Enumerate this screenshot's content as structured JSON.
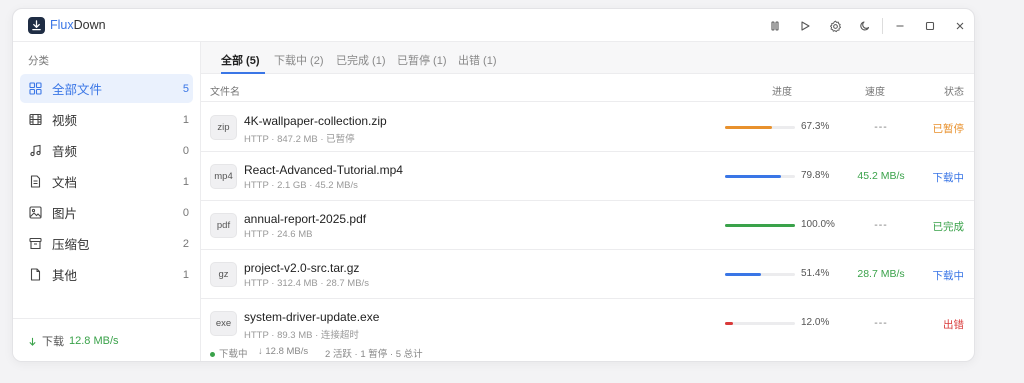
{
  "app": {
    "title_prefix": "Flux",
    "title_suffix": "Down"
  },
  "sidebar": {
    "heading": "分类",
    "items": [
      {
        "label": "全部文件",
        "count": "5",
        "icon": "grid-icon",
        "active": true
      },
      {
        "label": "视频",
        "count": "1",
        "icon": "film-icon"
      },
      {
        "label": "音频",
        "count": "0",
        "icon": "music-icon"
      },
      {
        "label": "文档",
        "count": "1",
        "icon": "document-icon"
      },
      {
        "label": "图片",
        "count": "0",
        "icon": "image-icon"
      },
      {
        "label": "压缩包",
        "count": "2",
        "icon": "archive-icon"
      },
      {
        "label": "其他",
        "count": "1",
        "icon": "file-icon"
      }
    ],
    "footer": {
      "label": "下载",
      "speed": "12.8 MB/s"
    }
  },
  "tabs": [
    {
      "label": "全部 (5)",
      "active": true
    },
    {
      "label": "下载中 (2)"
    },
    {
      "label": "已完成 (1)"
    },
    {
      "label": "已暂停 (1)"
    },
    {
      "label": "出错 (1)"
    }
  ],
  "columns": {
    "name": "文件名",
    "progress": "进度",
    "speed": "速度",
    "status": "状态"
  },
  "downloads": [
    {
      "ext": "zip",
      "name": "4K-wallpaper-collection.zip",
      "meta": "HTTP · 847.2 MB · 已暂停",
      "progress": 67.3,
      "progress_label": "67.3%",
      "speed": "---",
      "status": "已暂停",
      "color": "#e8912d"
    },
    {
      "ext": "mp4",
      "name": "React-Advanced-Tutorial.mp4",
      "meta": "HTTP · 2.1 GB · 45.2 MB/s",
      "progress": 79.8,
      "progress_label": "79.8%",
      "speed": "45.2 MB/s",
      "status": "下载中",
      "color": "#3a76e6"
    },
    {
      "ext": "pdf",
      "name": "annual-report-2025.pdf",
      "meta": "HTTP · 24.6 MB",
      "progress": 100.0,
      "progress_label": "100.0%",
      "speed": "---",
      "status": "已完成",
      "color": "#3aa24a"
    },
    {
      "ext": "gz",
      "name": "project-v2.0-src.tar.gz",
      "meta": "HTTP · 312.4 MB · 28.7 MB/s",
      "progress": 51.4,
      "progress_label": "51.4%",
      "speed": "28.7 MB/s",
      "status": "下载中",
      "color": "#3a76e6"
    },
    {
      "ext": "exe",
      "name": "system-driver-update.exe",
      "meta": "HTTP · 89.3 MB · 连接超时",
      "progress": 12.0,
      "progress_label": "12.0%",
      "speed": "---",
      "status": "出错",
      "color": "#d93a3a"
    }
  ],
  "statusbar": {
    "state": "下载中",
    "speed": "↓ 12.8 MB/s",
    "summary": "2 活跃 · 1 暂停 · 5 总计"
  }
}
